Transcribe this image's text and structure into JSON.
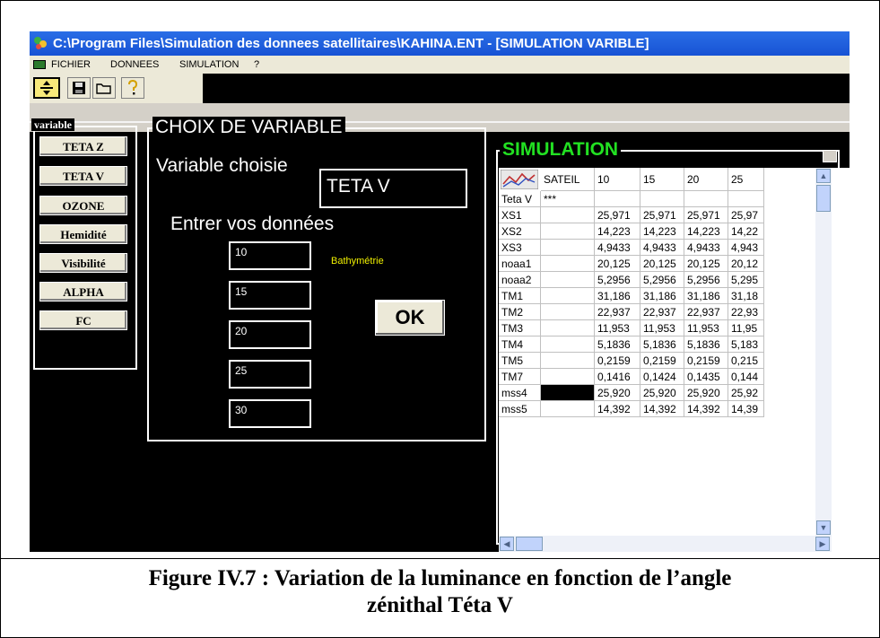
{
  "window": {
    "title": "C:\\Program Files\\Simulation des donnees satellitaires\\KAHINA.ENT - [SIMULATION VARIBLE]"
  },
  "menu": [
    "FICHIER",
    "DONNEES",
    "SIMULATION",
    "?"
  ],
  "toolbar": {
    "icons": [
      "resize-icon",
      "save-icon",
      "open-folder-icon",
      "help-icon"
    ]
  },
  "variable_panel": {
    "legend": "variable",
    "buttons": [
      "TETA Z",
      "TETA V",
      "OZONE",
      "Hemidité",
      "Visibilité",
      "ALPHA",
      "FC"
    ]
  },
  "choix_panel": {
    "legend": "CHOIX DE VARIABLE",
    "chosen_label": "Variable choisie",
    "chosen_value": "TETA V",
    "enter_label": "Entrer vos données",
    "inputs": [
      "10",
      "15",
      "20",
      "25",
      "30"
    ],
    "hint": "Bathymétrie",
    "ok_label": "OK"
  },
  "simulation_panel": {
    "legend": "SIMULATION",
    "columns": [
      "SATEIL",
      "10",
      "15",
      "20",
      "25"
    ],
    "rows": [
      {
        "label": "Teta V",
        "sat": "***",
        "values": [
          "",
          "",
          "",
          ""
        ]
      },
      {
        "label": "XS1",
        "sat": "",
        "values": [
          "25,971",
          "25,971",
          "25,971",
          "25,97"
        ]
      },
      {
        "label": "XS2",
        "sat": "",
        "values": [
          "14,223",
          "14,223",
          "14,223",
          "14,22"
        ]
      },
      {
        "label": "XS3",
        "sat": "",
        "values": [
          "4,9433",
          "4,9433",
          "4,9433",
          "4,943"
        ]
      },
      {
        "label": "noaa1",
        "sat": "",
        "values": [
          "20,125",
          "20,125",
          "20,125",
          "20,12"
        ]
      },
      {
        "label": "noaa2",
        "sat": "",
        "values": [
          "5,2956",
          "5,2956",
          "5,2956",
          "5,295"
        ]
      },
      {
        "label": "TM1",
        "sat": "",
        "values": [
          "31,186",
          "31,186",
          "31,186",
          "31,18"
        ]
      },
      {
        "label": "TM2",
        "sat": "",
        "values": [
          "22,937",
          "22,937",
          "22,937",
          "22,93"
        ]
      },
      {
        "label": "TM3",
        "sat": "",
        "values": [
          "11,953",
          "11,953",
          "11,953",
          "11,95"
        ]
      },
      {
        "label": "TM4",
        "sat": "",
        "values": [
          "5,1836",
          "5,1836",
          "5,1836",
          "5,183"
        ]
      },
      {
        "label": "TM5",
        "sat": "",
        "values": [
          "0,2159",
          "0,2159",
          "0,2159",
          "0,215"
        ]
      },
      {
        "label": "TM7",
        "sat": "",
        "values": [
          "0,1416",
          "0,1424",
          "0,1435",
          "0,144"
        ]
      },
      {
        "label": "mss4",
        "sat": "",
        "values": [
          "25,920",
          "25,920",
          "25,920",
          "25,92"
        ]
      },
      {
        "label": "mss5",
        "sat": "",
        "values": [
          "14,392",
          "14,392",
          "14,392",
          "14,39"
        ]
      }
    ]
  },
  "caption": {
    "line1": "Figure IV.7 : Variation de la luminance en fonction de l’angle",
    "line2": "zénithal Téta V"
  },
  "colors": {
    "titlebar": "#1752d4",
    "simulation_legend": "#22e022",
    "hint": "#f0f000",
    "background": "#000000"
  }
}
